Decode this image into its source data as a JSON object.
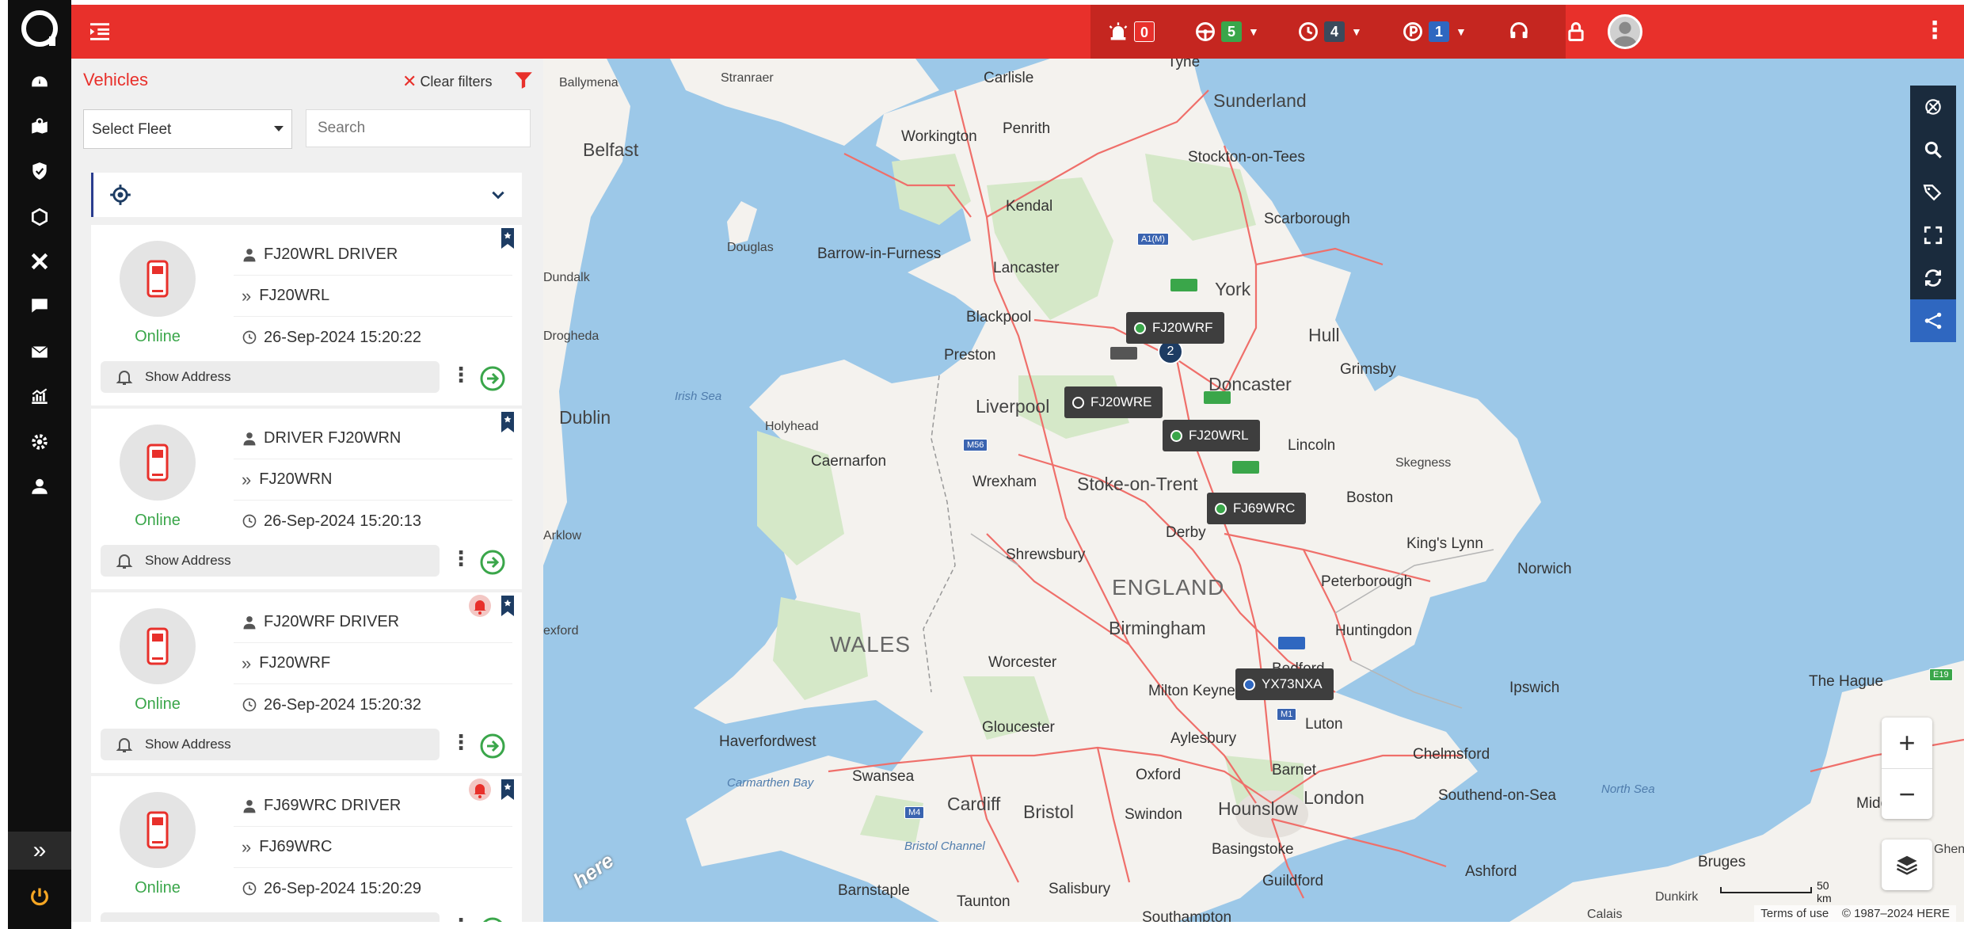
{
  "topbar": {
    "alarm_count": "0",
    "driving_count": "5",
    "idle_count": "4",
    "parked_count": "1",
    "colors": {
      "bar": "#e8302b",
      "alarm": "#e8302b",
      "driving": "#3aa64a",
      "idle": "#3b4a5c",
      "parked": "#2f67c0"
    }
  },
  "panel": {
    "title": "Vehicles",
    "clear_filters": "Clear filters",
    "fleet_select": "Select Fleet",
    "search_placeholder": "Search"
  },
  "vehicles": [
    {
      "driver": "FJ20WRL DRIVER",
      "reg": "FJ20WRL",
      "status": "Online",
      "timestamp": "26-Sep-2024 15:20:22",
      "address_label": "Show Address",
      "alert": false
    },
    {
      "driver": "DRIVER FJ20WRN",
      "reg": "FJ20WRN",
      "status": "Online",
      "timestamp": "26-Sep-2024 15:20:13",
      "address_label": "Show Address",
      "alert": false
    },
    {
      "driver": "FJ20WRF DRIVER",
      "reg": "FJ20WRF",
      "status": "Online",
      "timestamp": "26-Sep-2024 15:20:32",
      "address_label": "Show Address",
      "alert": true
    },
    {
      "driver": "FJ69WRC DRIVER",
      "reg": "FJ69WRC",
      "status": "Online",
      "timestamp": "26-Sep-2024 15:20:29",
      "address_label": "Show Address",
      "alert": true
    }
  ],
  "map": {
    "places": {
      "tyne": "Tyne",
      "carlisle": "Carlisle",
      "sunderland": "Sunderland",
      "ballymena": "Ballymena",
      "stranraer": "Stranraer",
      "penrith": "Penrith",
      "workington": "Workington",
      "stockton": "Stockton-on-Tees",
      "belfast": "Belfast",
      "kendal": "Kendal",
      "scarborough": "Scarborough",
      "douglas": "Douglas",
      "barrow": "Barrow-in-Furness",
      "lancaster": "Lancaster",
      "dundalk": "Dundalk",
      "york": "York",
      "blackpool": "Blackpool",
      "hull": "Hull",
      "drogheda": "Drogheda",
      "preston": "Preston",
      "grimsby": "Grimsby",
      "doncaster": "Doncaster",
      "liverpool": "Liverpool",
      "dublin": "Dublin",
      "holyhead": "Holyhead",
      "lincoln": "Lincoln",
      "caernarfon": "Caernarfon",
      "skegness": "Skegness",
      "wrexham": "Wrexham",
      "stoke": "Stoke-on-Trent",
      "boston": "Boston",
      "arklow": "Arklow",
      "derby": "Derby",
      "kingslynn": "King's Lynn",
      "shrewsbury": "Shrewsbury",
      "norwich": "Norwich",
      "england": "ENGLAND",
      "peterborough": "Peterborough",
      "birmingham": "Birmingham",
      "wexford": "exford",
      "wales": "WALES",
      "huntingdon": "Huntingdon",
      "worcester": "Worcester",
      "ipswich": "Ipswich",
      "miltonkeynes": "Milton Keyne",
      "bedford": "Bedford",
      "thehague": "The Hague",
      "gloucester": "Gloucester",
      "luton": "Luton",
      "haverfordwest": "Haverfordwest",
      "aylesbury": "Aylesbury",
      "chelmsford": "Chelmsford",
      "swansea": "Swansea",
      "oxford": "Oxford",
      "barnet": "Barnet",
      "cardiff": "Cardiff",
      "bristol": "Bristol",
      "london": "London",
      "southend": "Southend-on-Sea",
      "swindon": "Swindon",
      "hounslow": "Hounslow",
      "middelburg": "Middelburg",
      "ghent": "Ghent",
      "basingstoke": "Basingstoke",
      "ashford": "Ashford",
      "bruges": "Bruges",
      "barnstaple": "Barnstaple",
      "salisbury": "Salisbury",
      "guildford": "Guildford",
      "taunton": "Taunton",
      "dunkirk": "Dunkirk",
      "calais": "Calais",
      "southampton": "Southampton"
    },
    "seas": {
      "irish": "Irish Sea",
      "carmarthen": "Carmarthen Bay",
      "bristol_channel": "Bristol Channel",
      "north": "North Sea"
    },
    "roads": {
      "a1m": "A1(M)",
      "m56": "M56",
      "m1": "M1",
      "m4": "M4",
      "e19": "E19"
    },
    "vehicle_labels": [
      {
        "reg": "FJ20WRF",
        "dot": "#3aa64a"
      },
      {
        "reg": "FJ20WRE",
        "dot": "#3e3e3e"
      },
      {
        "reg": "FJ20WRL",
        "dot": "#3aa64a"
      },
      {
        "reg": "FJ69WRC",
        "dot": "#3aa64a"
      },
      {
        "reg": "YX73NXA",
        "dot": "#2f67c0"
      }
    ],
    "cluster_count": "2",
    "scale": "50 km",
    "terms": "Terms of use",
    "copyright": "© 1987–2024 HERE",
    "here": "here",
    "colors": {
      "water": "#9cc8e8",
      "land": "#f4f2ee",
      "green": "#d5e8c8",
      "road": "#ef6f6a"
    }
  }
}
